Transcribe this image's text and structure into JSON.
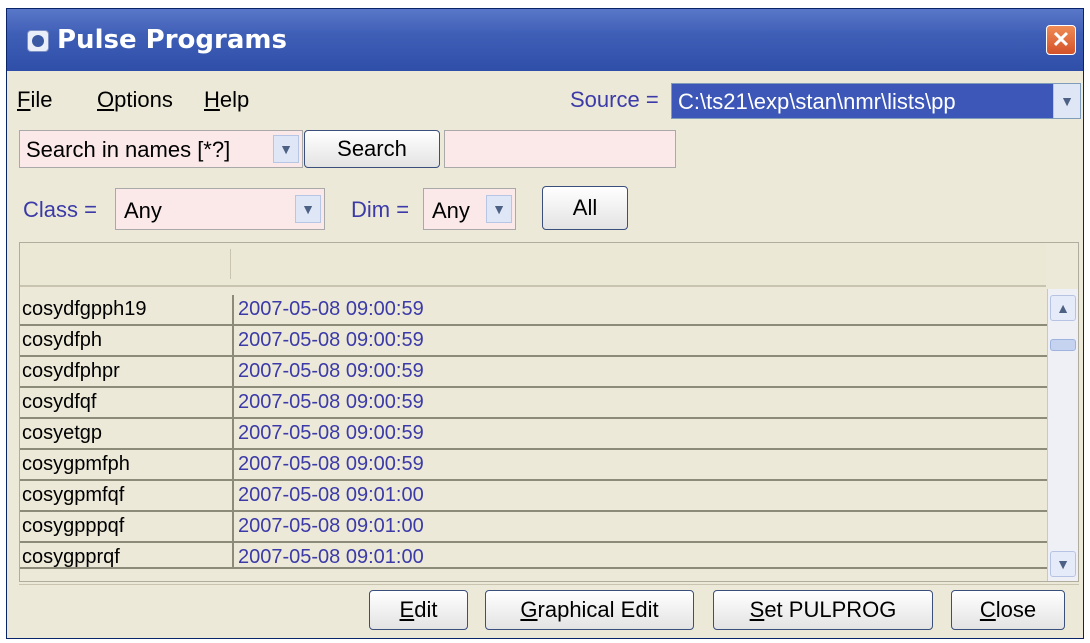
{
  "window": {
    "title": "Pulse Programs",
    "close_glyph": "✕"
  },
  "menu": {
    "items": [
      {
        "label_underlined": "F",
        "label_rest": "ile"
      },
      {
        "label_underlined": "O",
        "label_rest": "ptions"
      },
      {
        "label_underlined": "H",
        "label_rest": "elp"
      }
    ]
  },
  "source": {
    "label": "Source =",
    "value": "C:\\ts21\\exp\\stan\\nmr\\lists\\pp"
  },
  "search": {
    "mode": "Search in names [*?]",
    "button_label": "Search",
    "query": ""
  },
  "filters": {
    "class_label": "Class =",
    "class_value": "Any",
    "dim_label": "Dim =",
    "dim_value": "Any",
    "all_button": "All"
  },
  "table": {
    "rows": [
      {
        "name": "cosydfgpph19",
        "date": "2007-05-08 09:00:59"
      },
      {
        "name": "cosydfph",
        "date": "2007-05-08 09:00:59"
      },
      {
        "name": "cosydfphpr",
        "date": "2007-05-08 09:00:59"
      },
      {
        "name": "cosydfqf",
        "date": "2007-05-08 09:00:59"
      },
      {
        "name": "cosyetgp",
        "date": "2007-05-08 09:00:59"
      },
      {
        "name": "cosygpmfph",
        "date": "2007-05-08 09:00:59"
      },
      {
        "name": "cosygpmfqf",
        "date": "2007-05-08 09:01:00"
      },
      {
        "name": "cosygpppqf",
        "date": "2007-05-08 09:01:00"
      },
      {
        "name": "cosygpprqf",
        "date": "2007-05-08 09:01:00"
      }
    ]
  },
  "buttons": {
    "edit": {
      "underlined": "E",
      "rest": "dit"
    },
    "graphical_edit": {
      "underlined": "G",
      "rest": "raphical Edit"
    },
    "set_pulprog": {
      "underlined": "S",
      "rest": "et PULPROG"
    },
    "close": {
      "underlined": "C",
      "rest": "lose"
    }
  }
}
